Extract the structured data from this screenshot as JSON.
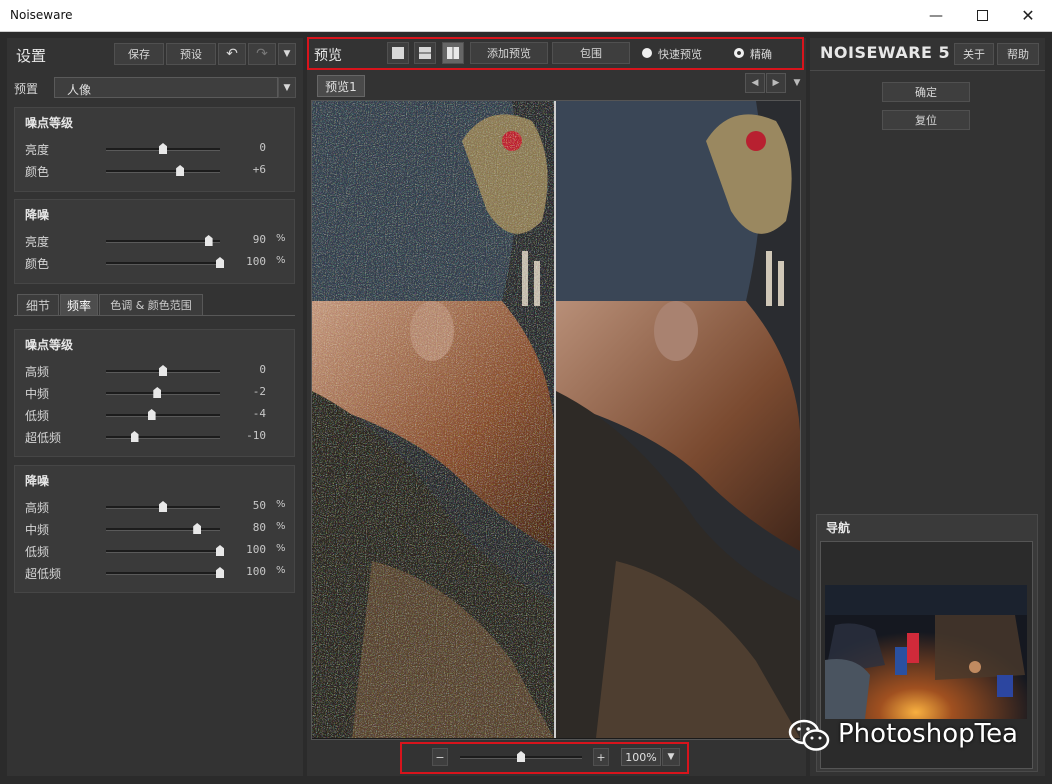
{
  "window": {
    "title": "Noiseware"
  },
  "left": {
    "header_title": "设置",
    "save_label": "保存",
    "preset_label": "预设",
    "preset_row_label": "预置",
    "preset_value": "人像",
    "noise_level": {
      "title": "噪点等级",
      "rows": [
        {
          "label": "亮度",
          "value": "0",
          "pos": 0.5
        },
        {
          "label": "颜色",
          "value": "+6",
          "pos": 0.65
        }
      ]
    },
    "denoise": {
      "title": "降噪",
      "rows": [
        {
          "label": "亮度",
          "value": "90",
          "unit": "%",
          "pos": 0.9
        },
        {
          "label": "颜色",
          "value": "100",
          "unit": "%",
          "pos": 1.0
        }
      ]
    },
    "tabs": [
      "细节",
      "频率",
      "色调 & 颜色范围"
    ],
    "active_tab": 1,
    "freq_noise": {
      "title": "噪点等级",
      "rows": [
        {
          "label": "高频",
          "value": "0",
          "pos": 0.5
        },
        {
          "label": "中频",
          "value": "-2",
          "pos": 0.45
        },
        {
          "label": "低频",
          "value": "-4",
          "pos": 0.4
        },
        {
          "label": "超低频",
          "value": "-10",
          "pos": 0.25
        }
      ]
    },
    "freq_denoise": {
      "title": "降噪",
      "rows": [
        {
          "label": "高频",
          "value": "50",
          "unit": "%",
          "pos": 0.5
        },
        {
          "label": "中频",
          "value": "80",
          "unit": "%",
          "pos": 0.8
        },
        {
          "label": "低频",
          "value": "100",
          "unit": "%",
          "pos": 1.0
        },
        {
          "label": "超低频",
          "value": "100",
          "unit": "%",
          "pos": 1.0
        }
      ]
    }
  },
  "center": {
    "toolbar_title": "预览",
    "add_preview_label": "添加预览",
    "surround_label": "包围",
    "fast_preview_label": "快速预览",
    "accurate_label": "精确",
    "preview_tab": "预览1",
    "zoom_value": "100%",
    "zoom_pos": 0.5
  },
  "right": {
    "logo": "NOISEWARE 5",
    "about_label": "关于",
    "help_label": "帮助",
    "ok_label": "确定",
    "reset_label": "复位",
    "navigator_title": "导航"
  },
  "watermark": {
    "text": "PhotoshopTea"
  },
  "colors": {
    "highlight": "#d8141c",
    "panel": "#333333"
  }
}
